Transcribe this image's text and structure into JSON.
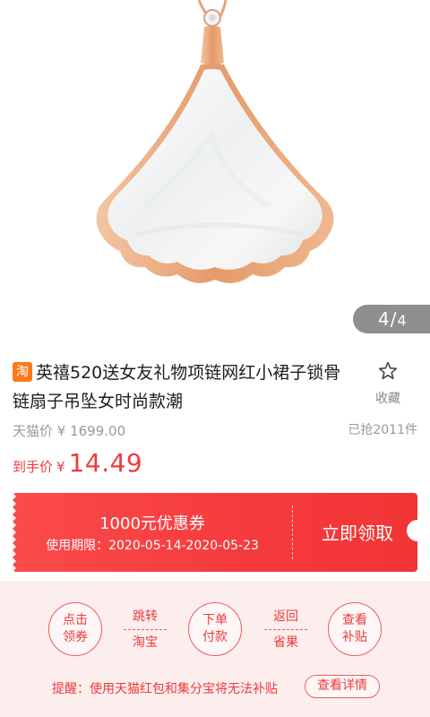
{
  "gallery": {
    "current": "4",
    "separator": "/",
    "total": "4"
  },
  "product": {
    "platform_badge": "淘",
    "title": "英禧520送女友礼物项链网红小裙子锁骨链扇子吊坠女时尚款潮",
    "favorite_label": "收藏",
    "original_price": "天猫价 ¥ 1699.00",
    "sold_count": "已抢2011件",
    "final_price_label": "到手价",
    "currency": "¥",
    "final_price": "14.49"
  },
  "coupon": {
    "amount": "1000元优惠券",
    "period": "使用期限：2020-05-14-2020-05-23",
    "claim": "立即领取"
  },
  "steps": {
    "step1": [
      "点击",
      "领券"
    ],
    "arrow1": [
      "跳转",
      "淘宝"
    ],
    "step2": [
      "下单",
      "付款"
    ],
    "arrow2": [
      "返回",
      "省果"
    ],
    "step3": [
      "查看",
      "补贴"
    ]
  },
  "reminder": {
    "text": "提醒：使用天猫红包和集分宝将无法补贴",
    "detail_button": "查看详情"
  },
  "colors": {
    "accent": "#f23a3c",
    "badge": "#ff7a1a",
    "panel_bg": "#fdeeee",
    "rose_gold": "#e8a67a"
  }
}
